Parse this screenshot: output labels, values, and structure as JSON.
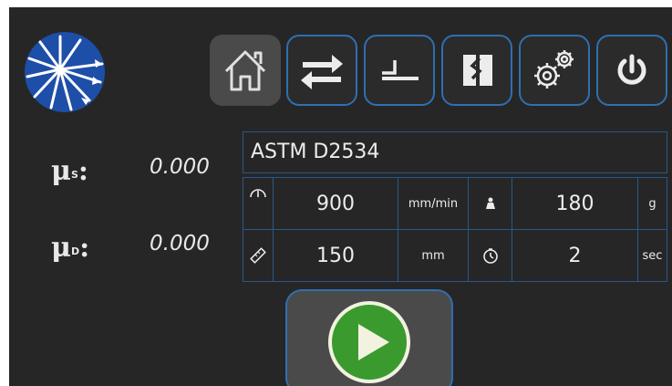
{
  "nav": {
    "home_icon": "home-icon",
    "swap_icon": "swap-arrows-icon",
    "sled_icon": "sled-icon",
    "calibrate_icon": "calibration-icon",
    "settings_icon": "gears-icon",
    "power_icon": "power-icon"
  },
  "results": {
    "static_symbol": "μ",
    "static_sub": "S",
    "static_colon": ":",
    "static_value": "0.000",
    "dynamic_symbol": "μ",
    "dynamic_sub": "D",
    "dynamic_colon": ":",
    "dynamic_value": "0.000"
  },
  "test": {
    "standard": "ASTM D2534",
    "speed_value": "900",
    "speed_unit": "mm/min",
    "weight_value": "180",
    "weight_unit": "g",
    "length_value": "150",
    "length_unit": "mm",
    "time_value": "2",
    "time_unit": "sec"
  },
  "colors": {
    "background": "#262626",
    "border": "#2f6fb2",
    "start_green": "#3a9a2e"
  }
}
